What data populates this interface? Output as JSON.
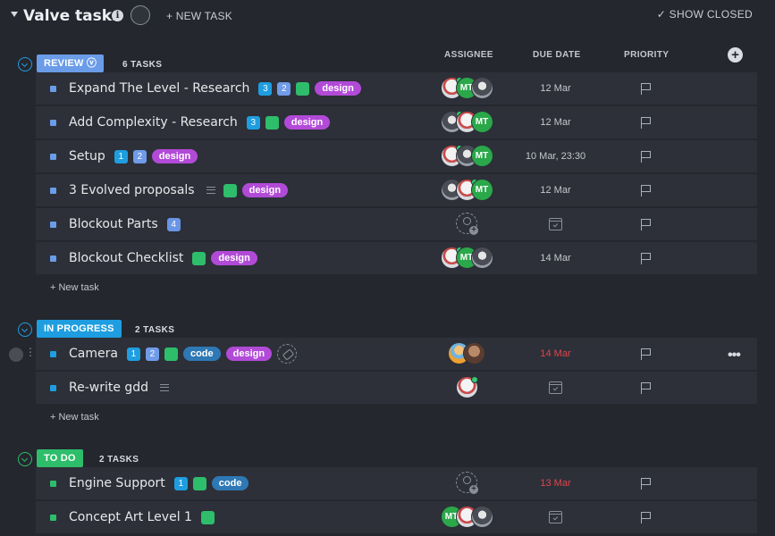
{
  "header": {
    "title": "Valve tasks",
    "new_task_label": "+ NEW TASK",
    "show_closed_label": "✓ SHOW CLOSED"
  },
  "columns": {
    "assignee": "ASSIGNEE",
    "due_date": "DUE DATE",
    "priority": "PRIORITY"
  },
  "colors": {
    "review": "#6a9ce8",
    "in_progress": "#1e9ee0",
    "to_do": "#2ebd6b",
    "design_tag": "#b24ad8",
    "code_tag": "#2e79b5",
    "overdue": "#e0454f"
  },
  "groups": [
    {
      "label": "REVIEW",
      "count": "6 TASKS",
      "tasks": [
        {
          "name": "Expand The Level - Research",
          "badges": [
            "3",
            "2"
          ],
          "check": true,
          "tags": [
            "design"
          ],
          "assignees": [
            "user-a",
            "MT",
            "user-b"
          ],
          "due": "12 Mar"
        },
        {
          "name": "Add Complexity - Research",
          "badges": [
            "3"
          ],
          "check": true,
          "tags": [
            "design"
          ],
          "assignees": [
            "user-b",
            "user-a",
            "MT"
          ],
          "due": "12 Mar"
        },
        {
          "name": "Setup",
          "badges": [
            "1",
            "2"
          ],
          "check": false,
          "tags": [
            "design"
          ],
          "assignees": [
            "user-a",
            "user-b",
            "MT"
          ],
          "due": "10 Mar, 23:30"
        },
        {
          "name": "3 Evolved proposals",
          "badges": [],
          "description": true,
          "check": true,
          "tags": [
            "design"
          ],
          "assignees": [
            "user-b",
            "user-a",
            "MT"
          ],
          "due": "12 Mar"
        },
        {
          "name": "Blockout Parts",
          "badges": [
            "4"
          ],
          "check": false,
          "tags": [],
          "assignees": [],
          "due": ""
        },
        {
          "name": "Blockout Checklist",
          "badges": [],
          "check": true,
          "tags": [
            "design"
          ],
          "assignees": [
            "user-a",
            "MT",
            "user-b"
          ],
          "due": "14 Mar"
        }
      ],
      "new_task": "+ New task"
    },
    {
      "label": "IN PROGRESS",
      "count": "2 TASKS",
      "tasks": [
        {
          "name": "Camera",
          "badges": [
            "1",
            "2"
          ],
          "check": true,
          "tags": [
            "code",
            "design"
          ],
          "assignees": [
            "user-c",
            "user-d"
          ],
          "due": "14 Mar",
          "overdue": true
        },
        {
          "name": "Re-write gdd",
          "badges": [],
          "description": true,
          "tags": [],
          "assignees": [
            "user-a"
          ],
          "due": ""
        }
      ],
      "new_task": "+ New task"
    },
    {
      "label": "TO DO",
      "count": "2 TASKS",
      "tasks": [
        {
          "name": "Engine Support",
          "badges": [
            "1"
          ],
          "check": true,
          "tags": [
            "code"
          ],
          "assignees": [],
          "due": "13 Mar",
          "overdue": true
        },
        {
          "name": "Concept Art Level 1",
          "badges": [],
          "check": true,
          "tags": [],
          "assignees": [
            "MT",
            "user-a",
            "user-b"
          ],
          "due": ""
        }
      ]
    }
  ]
}
